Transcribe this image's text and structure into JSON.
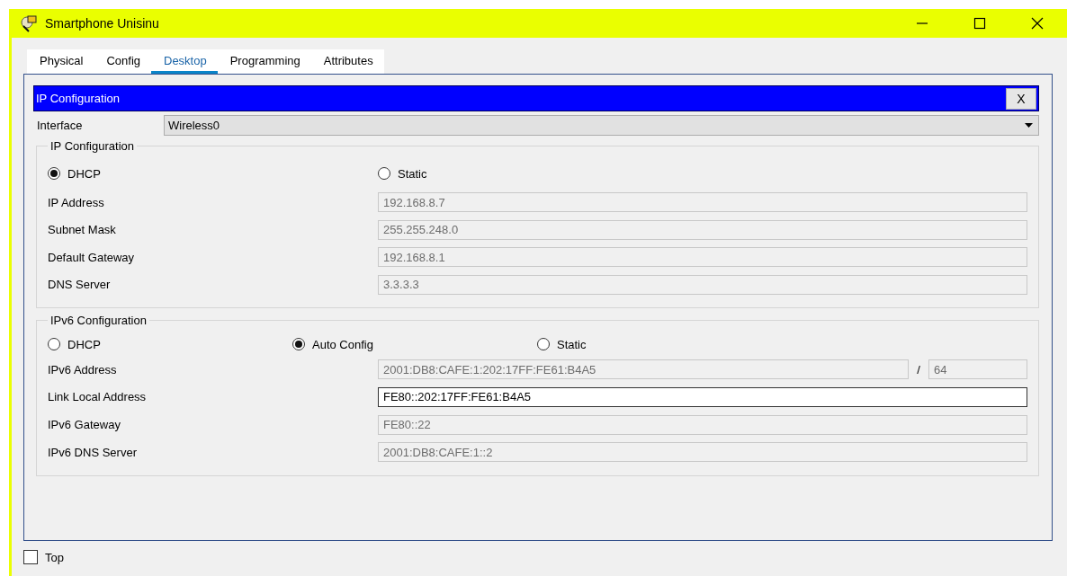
{
  "window": {
    "title": "Smartphone Unisinu"
  },
  "tabs": [
    {
      "label": "Physical",
      "selected": false
    },
    {
      "label": "Config",
      "selected": false
    },
    {
      "label": "Desktop",
      "selected": true
    },
    {
      "label": "Programming",
      "selected": false
    },
    {
      "label": "Attributes",
      "selected": false
    }
  ],
  "app": {
    "title": "IP Configuration",
    "close_label": "X"
  },
  "interface": {
    "label": "Interface",
    "value": "Wireless0"
  },
  "ipv4": {
    "title": "IP Configuration",
    "modes": [
      {
        "label": "DHCP",
        "selected": true
      },
      {
        "label": "Static",
        "selected": false
      }
    ],
    "fields": [
      {
        "label": "IP Address",
        "value": "192.168.8.7",
        "editable": false
      },
      {
        "label": "Subnet Mask",
        "value": "255.255.248.0",
        "editable": false
      },
      {
        "label": "Default Gateway",
        "value": "192.168.8.1",
        "editable": false
      },
      {
        "label": "DNS Server",
        "value": "3.3.3.3",
        "editable": false
      }
    ]
  },
  "ipv6": {
    "title": "IPv6 Configuration",
    "modes": [
      {
        "label": "DHCP",
        "selected": false
      },
      {
        "label": "Auto Config",
        "selected": true
      },
      {
        "label": "Static",
        "selected": false
      }
    ],
    "fields": [
      {
        "label": "IPv6 Address",
        "value": "2001:DB8:CAFE:1:202:17FF:FE61:B4A5",
        "editable": false,
        "separator": "/",
        "prefix": "64"
      },
      {
        "label": "Link Local Address",
        "value": "FE80::202:17FF:FE61:B4A5",
        "editable": true
      },
      {
        "label": "IPv6 Gateway",
        "value": "FE80::22",
        "editable": false
      },
      {
        "label": "IPv6 DNS Server",
        "value": "2001:DB8:CAFE:1::2",
        "editable": false
      }
    ]
  },
  "top": {
    "label": "Top",
    "checked": false
  }
}
